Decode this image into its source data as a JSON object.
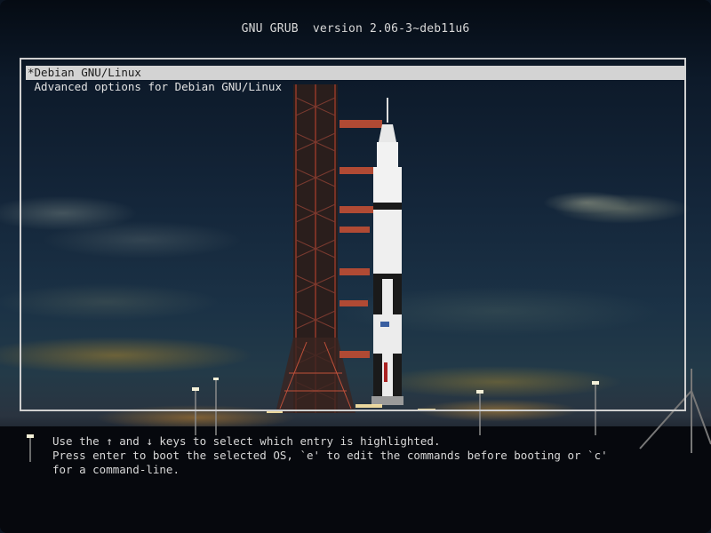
{
  "header": {
    "title": "GNU GRUB  version 2.06-3~deb11u6"
  },
  "menu": {
    "selected_index": 0,
    "entries": [
      {
        "label": "*Debian GNU/Linux"
      },
      {
        "label": " Advanced options for Debian GNU/Linux"
      }
    ]
  },
  "help": {
    "line1": "Use the ↑ and ↓ keys to select which entry is highlighted.",
    "line2": "Press enter to boot the selected OS, `e' to edit the commands before booting or `c'",
    "line3": "for a command-line."
  },
  "colors": {
    "text": "#d8d8d8",
    "selected_bg": "#d3d3d3",
    "selected_fg": "#1a1a1a",
    "border": "#cfcfcf"
  }
}
